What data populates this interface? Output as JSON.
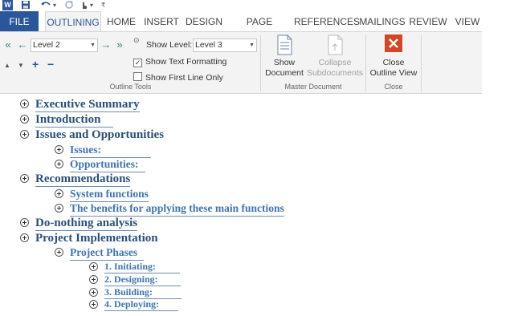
{
  "qat": {
    "word_icon": "W",
    "save_icon": "save-icon",
    "undo_icon": "undo-icon",
    "redo_icon": "redo-icon",
    "touch_icon": "touch-icon",
    "customize_icon": "customize-icon"
  },
  "tabs": [
    {
      "label": "FILE"
    },
    {
      "label": "OUTLINING"
    },
    {
      "label": "HOME"
    },
    {
      "label": "INSERT"
    },
    {
      "label": "DESIGN"
    },
    {
      "label": "PAGE LAYOUT"
    },
    {
      "label": "REFERENCES"
    },
    {
      "label": "MAILINGS"
    },
    {
      "label": "REVIEW"
    },
    {
      "label": "VIEW"
    }
  ],
  "outline_tools": {
    "level_value": "Level 2",
    "show_level_label": "Show Level:",
    "show_level_value": "Level 3",
    "show_text_formatting": "Show Text Formatting",
    "show_text_formatting_checked": "✓",
    "show_first_line_only": "Show First Line Only",
    "group_label": "Outline Tools"
  },
  "master_document": {
    "show_document_line1": "Show",
    "show_document_line2": "Document",
    "collapse_line1": "Collapse",
    "collapse_line2": "Subdocuments",
    "group_label": "Master Document"
  },
  "close_group": {
    "close_line1": "Close",
    "close_line2": "Outline View",
    "group_label": "Close"
  },
  "outline": [
    {
      "level": 1,
      "text": "Executive Summary"
    },
    {
      "level": 1,
      "text": "Introduction"
    },
    {
      "level": 1,
      "text": "Issues and Opportunities"
    },
    {
      "level": 2,
      "text": "Issues:"
    },
    {
      "level": 2,
      "text": "Opportunities:"
    },
    {
      "level": 1,
      "text": "Recommendations"
    },
    {
      "level": 2,
      "text": "System functions"
    },
    {
      "level": 2,
      "text": "The benefits for applying these main functions"
    },
    {
      "level": 1,
      "text": "Do-nothing analysis"
    },
    {
      "level": 1,
      "text": "Project Implementation"
    },
    {
      "level": 2,
      "text": "Project Phases"
    },
    {
      "level": 3,
      "text": "1. Initiating:"
    },
    {
      "level": 3,
      "text": "2. Designing:"
    },
    {
      "level": 3,
      "text": "3. Building:"
    },
    {
      "level": 3,
      "text": "4. Deploying:"
    }
  ],
  "colors": {
    "file_tab": "#2b579a",
    "close_icon": "#d24726",
    "heading": "#2e5a86",
    "arrow": "#2e8b57"
  }
}
